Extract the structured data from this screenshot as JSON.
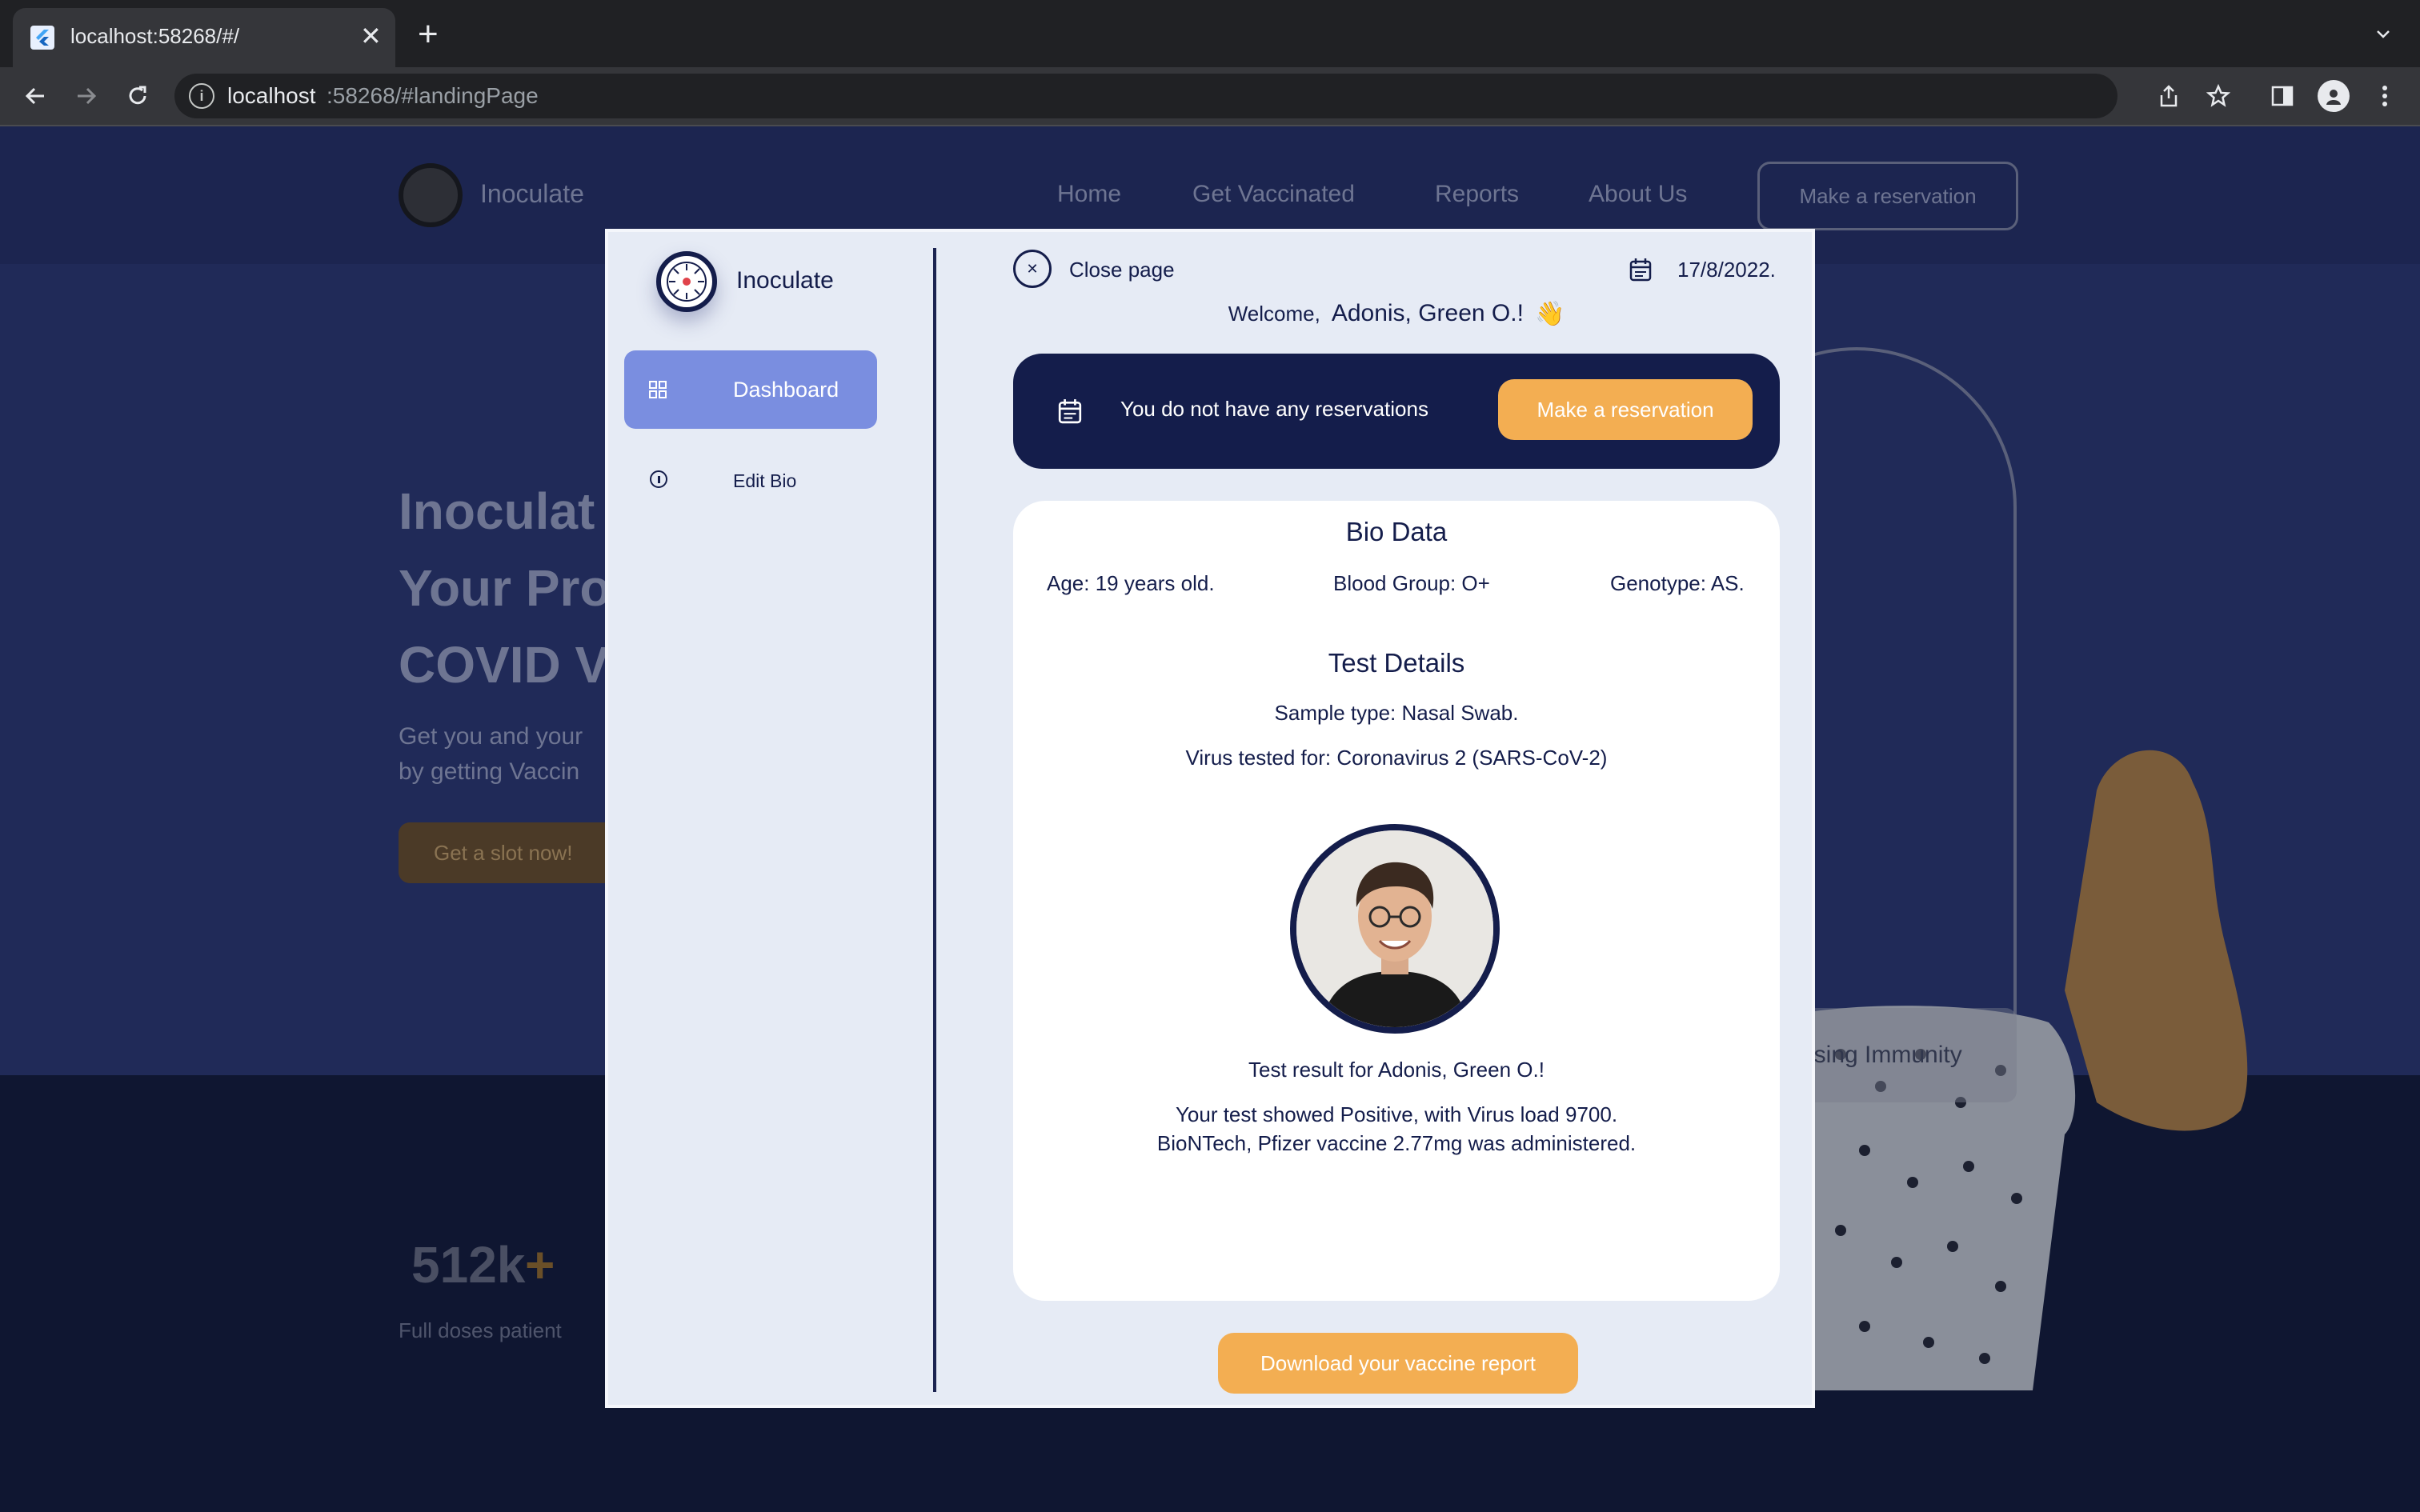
{
  "browser": {
    "tab_title": "localhost:58268/#/",
    "new_tab": "+",
    "url_host": "localhost",
    "url_rest": ":58268/#landingPage"
  },
  "background": {
    "brand": "Inoculate",
    "nav": [
      "Home",
      "Get Vaccinated",
      "Reports",
      "About Us"
    ],
    "nav_button": "Make a reservation",
    "hero_lines": [
      "Inoculat",
      "Your Pro",
      "COVID V"
    ],
    "hero_sub": [
      "Get you and your",
      "by getting Vaccin"
    ],
    "hero_button": "Get a slot now!",
    "stat_value": "512k",
    "stat_plus": "+",
    "stat_label": "Full doses patient",
    "badge_text": "using Immunity"
  },
  "modal": {
    "brand": "Inoculate",
    "sidebar": [
      {
        "label": "Dashboard",
        "icon": "dashboard-icon",
        "active": true
      },
      {
        "label": "Edit Bio",
        "icon": "info-icon",
        "active": false
      }
    ],
    "close_label": "Close page",
    "date": "17/8/2022.",
    "welcome_prefix": "Welcome,",
    "welcome_name": "Adonis, Green O.!",
    "wave_emoji": "👋",
    "banner": {
      "text": "You do not have any reservations",
      "button": "Make a reservation"
    },
    "bio": {
      "title": "Bio Data",
      "age": "Age: 19 years old.",
      "blood_group": "Blood Group: O+",
      "genotype": "Genotype: AS."
    },
    "test": {
      "title": "Test Details",
      "sample": "Sample type: Nasal Swab.",
      "virus": "Virus tested for: Coronavirus 2 (SARS-CoV-2)",
      "result_for": "Test result for Adonis, Green O.!",
      "result_line1": "Your test showed Positive, with Virus load 9700.",
      "result_line2": "BioNTech, Pfizer vaccine 2.77mg was administered."
    },
    "download_button": "Download your vaccine report"
  },
  "colors": {
    "accent": "#f3ae52",
    "navy": "#141d4b",
    "active_nav": "#7a8ee0",
    "modal_bg": "#e6ebf5"
  }
}
